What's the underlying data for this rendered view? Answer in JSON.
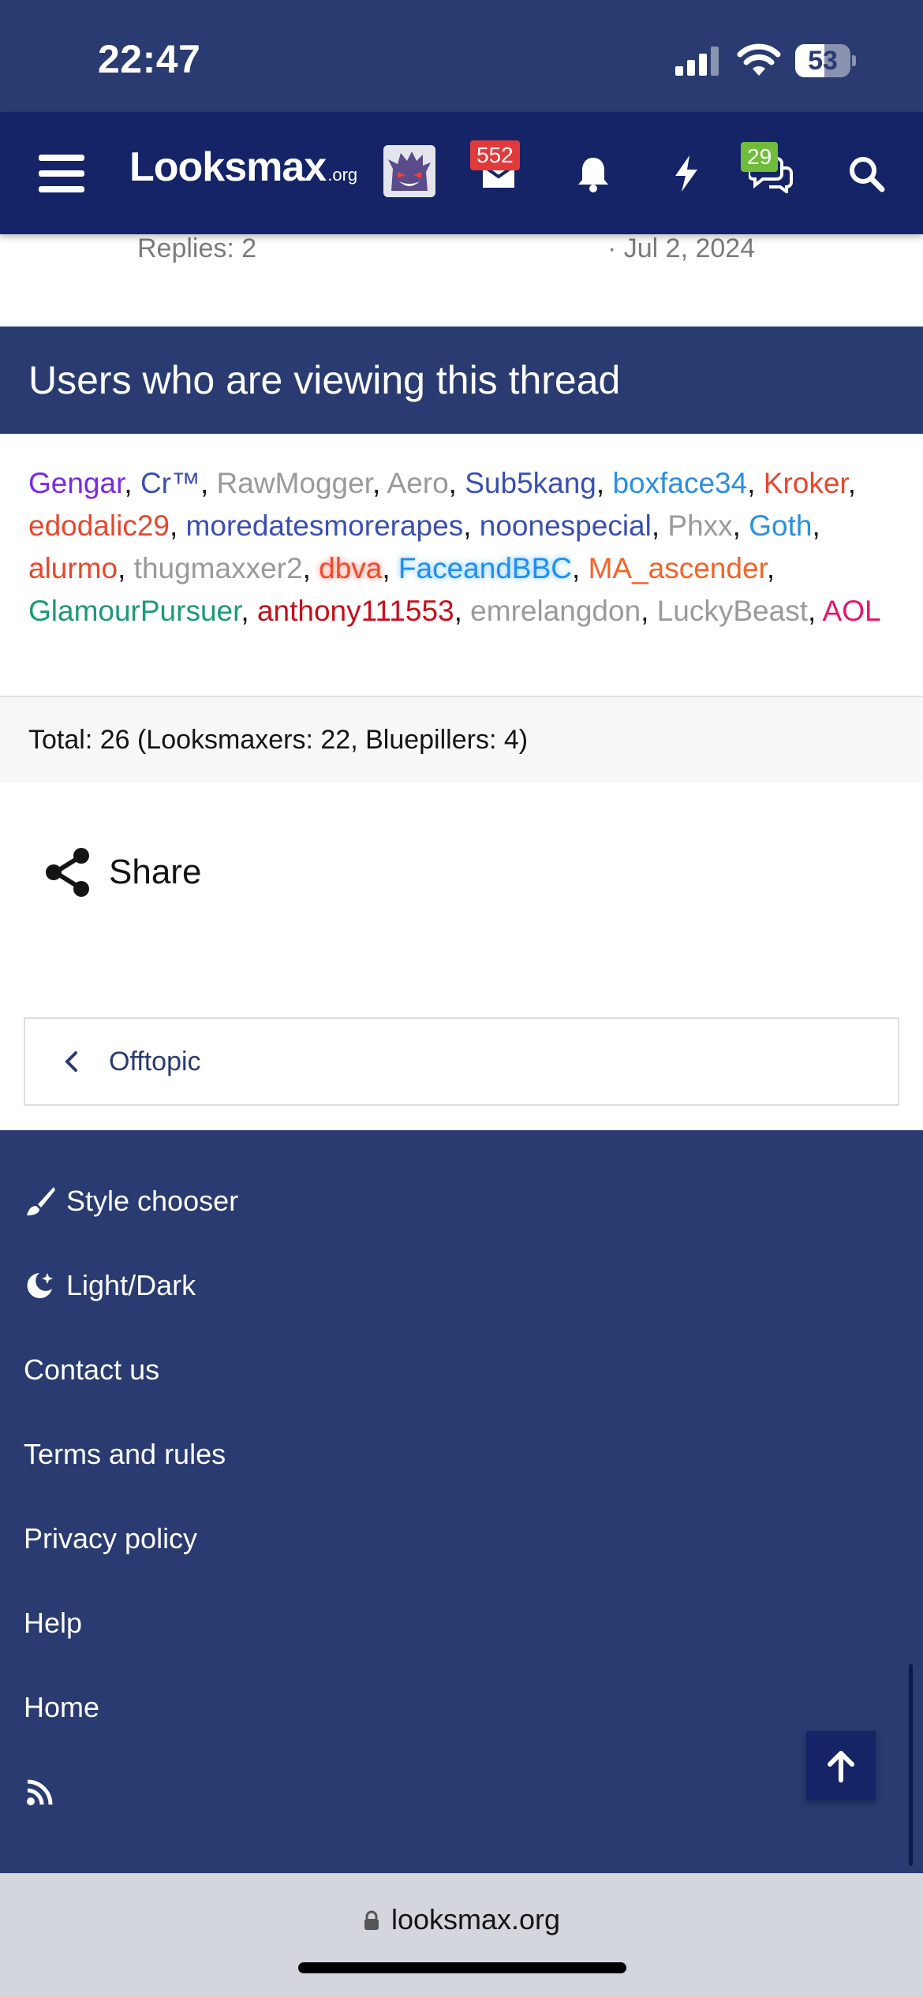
{
  "status_bar": {
    "time": "22:47",
    "battery_level": "53"
  },
  "navbar": {
    "logo_word": "Looksmax",
    "logo_tld": ".org",
    "inbox_badge": "552",
    "alerts_badge": "29",
    "icons": [
      "menu-icon",
      "avatar",
      "inbox-icon",
      "bell-icon",
      "lightning-icon",
      "chat-icon",
      "search-icon"
    ]
  },
  "thread_end": {
    "replies": "Replies: 2",
    "date": "· Jul 2, 2024"
  },
  "viewers": {
    "title": "Users who are viewing this thread",
    "users": [
      {
        "name": "Gengar",
        "color": "#7a2be2"
      },
      {
        "name": "Cr™",
        "color": "#3a50b0"
      },
      {
        "name": "RawMogger",
        "color": "#9a9a9a"
      },
      {
        "name": "Aero",
        "color": "#9a9a9a"
      },
      {
        "name": "Sub5kang",
        "color": "#3a50b0"
      },
      {
        "name": "boxface34",
        "color": "#2b8fe0"
      },
      {
        "name": "Kroker",
        "color": "#e8472d"
      },
      {
        "name": "edodalic29",
        "color": "#e8472d"
      },
      {
        "name": "moredatesmorerapes",
        "color": "#3a50b0"
      },
      {
        "name": "noonespecial",
        "color": "#3a50b0"
      },
      {
        "name": "Phxx",
        "color": "#9a9a9a"
      },
      {
        "name": "Goth",
        "color": "#2b8fe0"
      },
      {
        "name": "alurmo",
        "color": "#e8472d"
      },
      {
        "name": "thugmaxxer2",
        "color": "#9a9a9a"
      },
      {
        "name": "dbva",
        "color": "#f04a2e",
        "glow": "#ffb4a6"
      },
      {
        "name": "FaceandBBC",
        "color": "#1f8ff0",
        "glow": "#a9d8ff"
      },
      {
        "name": "MA_ascender",
        "color": "#f2642a"
      },
      {
        "name": "GlamourPursuer",
        "color": "#1a9a7a"
      },
      {
        "name": "anthony111553",
        "color": "#c4101a"
      },
      {
        "name": "emrelangdon",
        "color": "#9a9a9a"
      },
      {
        "name": "LuckyBeast",
        "color": "#9a9a9a"
      },
      {
        "name": "AOL",
        "color": "#e8146a"
      }
    ],
    "total": "Total: 26 (Looksmaxers: 22, Bluepillers: 4)"
  },
  "share": {
    "label": "Share"
  },
  "breadcrumb": {
    "label": "Offtopic"
  },
  "footer": {
    "items": [
      {
        "label": "Style chooser",
        "icon": "brush-icon"
      },
      {
        "label": "Light/Dark",
        "icon": "moon-icon"
      },
      {
        "label": "Contact us"
      },
      {
        "label": "Terms and rules"
      },
      {
        "label": "Privacy policy"
      },
      {
        "label": "Help"
      },
      {
        "label": "Home"
      }
    ],
    "rss_icon": "rss-icon",
    "to_top_icon": "arrow-up-icon"
  },
  "browser": {
    "url": "looksmax.org"
  },
  "colors": {
    "header_blue": "#293b70",
    "navbar_navy": "#142467",
    "link_blue": "#293b70"
  }
}
